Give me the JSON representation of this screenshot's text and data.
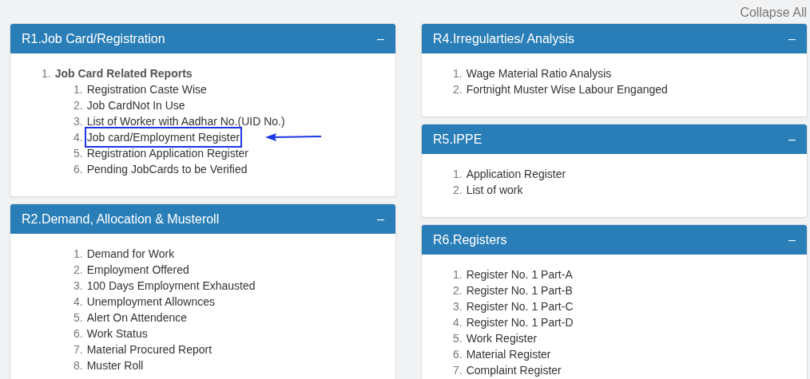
{
  "collapse_all": "Collapse All",
  "columns": [
    {
      "panels": [
        {
          "title": "R1.Job Card/Registration",
          "toggle": "–",
          "indented": false,
          "items": [
            {
              "number": "1.",
              "text": "Job Card Related Reports",
              "bold": true,
              "highlighted": false,
              "children": [
                {
                  "number": "1.",
                  "text": "Registration Caste Wise",
                  "bold": false,
                  "highlighted": false
                },
                {
                  "number": "2.",
                  "text": "Job CardNot In Use",
                  "bold": false,
                  "highlighted": false
                },
                {
                  "number": "3.",
                  "text": "List of Worker with Aadhar No.(UID No.)",
                  "bold": false,
                  "highlighted": false
                },
                {
                  "number": "4.",
                  "text": "Job card/Employment Register",
                  "bold": false,
                  "highlighted": true
                },
                {
                  "number": "5.",
                  "text": "Registration Application Register",
                  "bold": false,
                  "highlighted": false
                },
                {
                  "number": "6.",
                  "text": "Pending JobCards to be Verified",
                  "bold": false,
                  "highlighted": false
                }
              ]
            }
          ]
        },
        {
          "title": "R2.Demand, Allocation & Musteroll",
          "toggle": "–",
          "indented": true,
          "items": [
            {
              "number": "1.",
              "text": "Demand for Work",
              "bold": false,
              "highlighted": false
            },
            {
              "number": "2.",
              "text": "Employment Offered",
              "bold": false,
              "highlighted": false
            },
            {
              "number": "3.",
              "text": "100 Days Employment Exhausted",
              "bold": false,
              "highlighted": false
            },
            {
              "number": "4.",
              "text": "Unemployment Allownces",
              "bold": false,
              "highlighted": false
            },
            {
              "number": "5.",
              "text": "Alert On Attendence",
              "bold": false,
              "highlighted": false
            },
            {
              "number": "6.",
              "text": "Work Status",
              "bold": false,
              "highlighted": false
            },
            {
              "number": "7.",
              "text": "Material Procured Report",
              "bold": false,
              "highlighted": false
            },
            {
              "number": "8.",
              "text": "Muster Roll",
              "bold": false,
              "highlighted": false
            }
          ]
        }
      ]
    },
    {
      "panels": [
        {
          "title": "R4.Irregularties/ Analysis",
          "toggle": "–",
          "indented": false,
          "items": [
            {
              "number": "1.",
              "text": "Wage Material Ratio Analysis",
              "bold": false,
              "highlighted": false
            },
            {
              "number": "2.",
              "text": "Fortnight Muster Wise Labour Enganged",
              "bold": false,
              "highlighted": false
            }
          ]
        },
        {
          "title": "R5.IPPE",
          "toggle": "–",
          "indented": false,
          "items": [
            {
              "number": "1.",
              "text": "Application Register",
              "bold": false,
              "highlighted": false
            },
            {
              "number": "2.",
              "text": "List of work",
              "bold": false,
              "highlighted": false
            }
          ]
        },
        {
          "title": "R6.Registers",
          "toggle": "–",
          "indented": false,
          "items": [
            {
              "number": "1.",
              "text": "Register No. 1 Part-A",
              "bold": false,
              "highlighted": false
            },
            {
              "number": "2.",
              "text": "Register No. 1 Part-B",
              "bold": false,
              "highlighted": false
            },
            {
              "number": "3.",
              "text": "Register No. 1 Part-C",
              "bold": false,
              "highlighted": false
            },
            {
              "number": "4.",
              "text": "Register No. 1 Part-D",
              "bold": false,
              "highlighted": false
            },
            {
              "number": "5.",
              "text": "Work Register",
              "bold": false,
              "highlighted": false
            },
            {
              "number": "6.",
              "text": "Material Register",
              "bold": false,
              "highlighted": false
            },
            {
              "number": "7.",
              "text": "Complaint Register",
              "bold": false,
              "highlighted": false
            }
          ]
        }
      ]
    }
  ]
}
